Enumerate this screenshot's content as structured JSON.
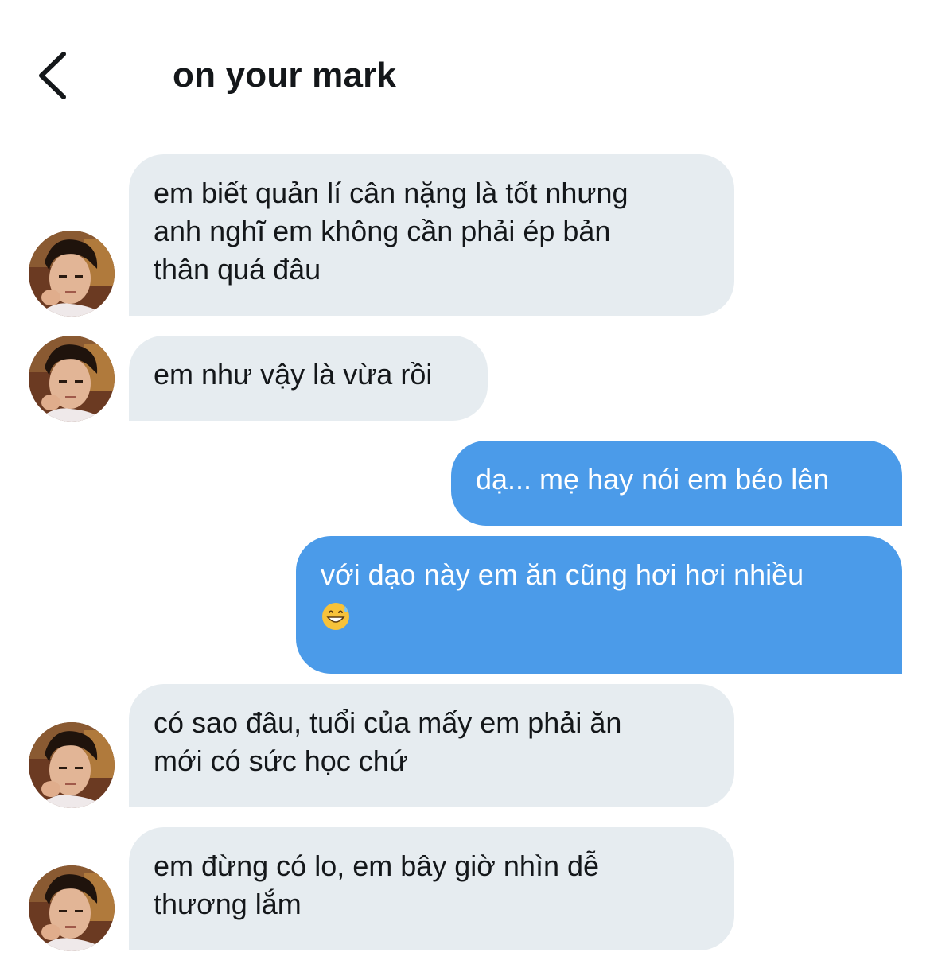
{
  "header": {
    "back_icon": "chevron-left-icon",
    "title": "on your mark"
  },
  "colors": {
    "received_bubble": "#e6ecf0",
    "sent_bubble": "#4b9be9",
    "text_dark": "#14171a",
    "text_light": "#ffffff"
  },
  "messages": [
    {
      "direction": "received",
      "lines": [
        "em biết quản lí cân nặng là tốt nhưng",
        "anh nghĩ em không cần phải ép bản",
        "thân quá đâu"
      ]
    },
    {
      "direction": "received",
      "lines": [
        "em như vậy là vừa rồi"
      ]
    },
    {
      "direction": "sent",
      "lines": [
        "dạ... mẹ hay nói em béo lên"
      ]
    },
    {
      "direction": "sent",
      "lines": [
        "với dạo này em ăn cũng hơi hơi nhiều"
      ],
      "emoji": "grinning-face-with-sweat-emoji"
    },
    {
      "direction": "received",
      "lines": [
        "có sao đâu, tuổi của mấy em phải ăn",
        "mới có sức học chứ"
      ]
    },
    {
      "direction": "received",
      "lines": [
        "em đừng có lo, em bây giờ nhìn dễ",
        "thương lắm"
      ]
    }
  ]
}
